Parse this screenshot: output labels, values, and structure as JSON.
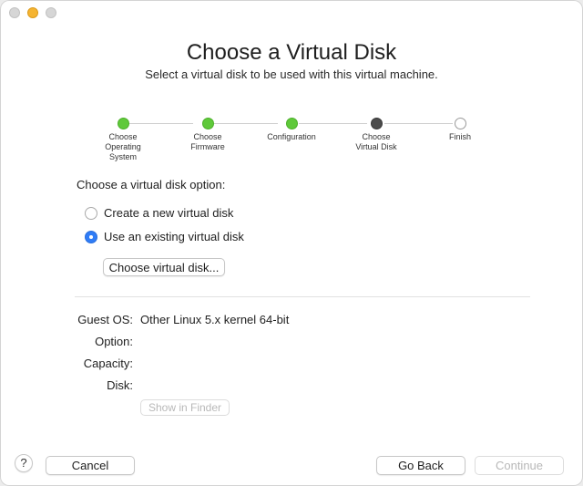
{
  "window": {
    "title": "Choose a Virtual Disk",
    "subtitle": "Select a virtual disk to be used with this virtual machine."
  },
  "stepper": {
    "steps": [
      {
        "label": "Choose\nOperating\nSystem",
        "state": "done"
      },
      {
        "label": "Choose\nFirmware",
        "state": "done"
      },
      {
        "label": "Configuration",
        "state": "done"
      },
      {
        "label": "Choose\nVirtual Disk",
        "state": "current"
      },
      {
        "label": "Finish",
        "state": "pending"
      }
    ]
  },
  "options": {
    "prompt": "Choose a virtual disk option:",
    "create_new": "Create a new virtual disk",
    "use_existing": "Use an existing virtual disk",
    "selected": "use_existing",
    "choose_disk_button": "Choose virtual disk..."
  },
  "info": {
    "guest_os_label": "Guest OS:",
    "guest_os_value": "Other Linux 5.x kernel 64-bit",
    "option_label": "Option:",
    "option_value": "",
    "capacity_label": "Capacity:",
    "capacity_value": "",
    "disk_label": "Disk:",
    "disk_value": "",
    "show_in_finder": "Show in Finder"
  },
  "footer": {
    "help": "?",
    "cancel": "Cancel",
    "go_back": "Go Back",
    "continue": "Continue"
  },
  "colors": {
    "step_done": "#5fc93a",
    "step_current": "#4b4b4b",
    "radio_selected": "#2f7cf6",
    "minimize_light": "#f5b431"
  }
}
